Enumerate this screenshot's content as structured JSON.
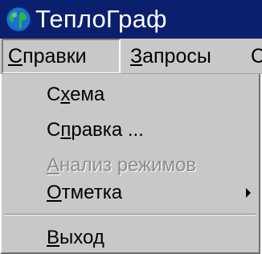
{
  "window": {
    "title": "ТеплоГраф",
    "icon": "globe-icon"
  },
  "menubar": {
    "items": [
      {
        "label": "Справки",
        "mnemonic_char": "С",
        "rest": "правки",
        "open": true
      },
      {
        "label": "Запросы",
        "mnemonic_char": "З",
        "rest": "апросы",
        "open": false
      },
      {
        "label": "С",
        "mnemonic_char": "",
        "rest": "С",
        "open": false
      }
    ]
  },
  "dropdown": {
    "items": [
      {
        "label": "Схема",
        "pre": "С",
        "mnemonic": "х",
        "post": "ема",
        "enabled": true,
        "submenu": false
      },
      {
        "label": "Справка ...",
        "pre": "С",
        "mnemonic": "п",
        "post": "равка ...",
        "enabled": true,
        "submenu": false
      },
      {
        "label": "Анализ режимов",
        "pre": "",
        "mnemonic": "А",
        "post": "нализ режимов",
        "enabled": false,
        "submenu": false
      },
      {
        "label": "Отметка",
        "pre": "",
        "mnemonic": "О",
        "post": "тметка",
        "enabled": true,
        "submenu": true
      },
      {
        "label": "Выход",
        "pre": "",
        "mnemonic": "В",
        "post": "ыход",
        "enabled": true,
        "submenu": false
      }
    ]
  },
  "colors": {
    "titlebar": "#0a1f6e",
    "menu_bg": "#c8c8c8",
    "disabled_text": "#8c8c8c"
  }
}
